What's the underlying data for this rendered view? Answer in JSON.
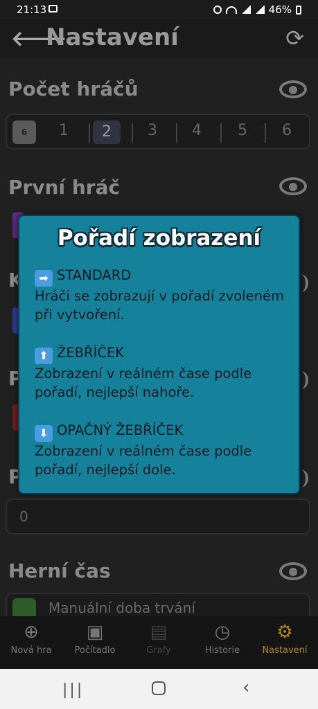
{
  "status": {
    "time": "21:13",
    "battery": "46%"
  },
  "appbar": {
    "title": "Nastavení"
  },
  "sections": {
    "players_count": "Počet hráčů",
    "first_player": "První hráč",
    "game_time": "Herní čas"
  },
  "players_options": [
    "1",
    "2",
    "3",
    "4",
    "5",
    "6"
  ],
  "players_selected": "2",
  "players_icon_badge": "6",
  "hidden_letters": [
    "K",
    "P",
    "P"
  ],
  "score_field_value": "0",
  "game_time_value": "Manuální doba trvání",
  "dialog": {
    "title": "Pořadí zobrazení",
    "options": [
      {
        "icon": "➡",
        "name": "STANDARD",
        "desc": "Hráči se zobrazují v pořadí zvoleném při vytvoření."
      },
      {
        "icon": "⬆",
        "name": "ŽEBŘÍČEK",
        "desc": "Zobrazení v reálném čase podle pořadí, nejlepší nahoře."
      },
      {
        "icon": "⬇",
        "name": "OPAČNÝ ŽEBŘÍČEK",
        "desc": "Zobrazení v reálném čase podle pořadí, nejlepší dole."
      }
    ]
  },
  "nav": [
    {
      "label": "Nová hra"
    },
    {
      "label": "Počítadlo"
    },
    {
      "label": "Grafy"
    },
    {
      "label": "Historie"
    },
    {
      "label": "Nastavení"
    }
  ],
  "colors": {
    "dialog_bg": "#16819a",
    "active_nav": "#b08a1a"
  }
}
